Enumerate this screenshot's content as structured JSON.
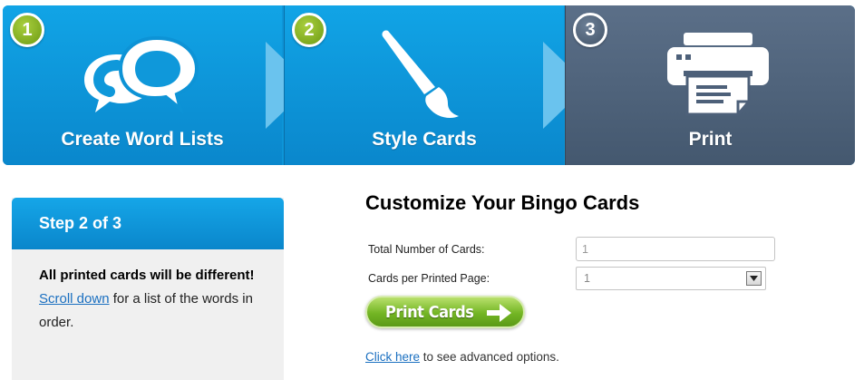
{
  "steps": [
    {
      "number": "1",
      "label": "Create Word Lists",
      "icon": "speech-bubbles-icon",
      "state": "complete"
    },
    {
      "number": "2",
      "label": "Style Cards",
      "icon": "paintbrush-icon",
      "state": "current"
    },
    {
      "number": "3",
      "label": "Print",
      "icon": "printer-icon",
      "state": "upcoming"
    }
  ],
  "sidebar": {
    "heading": "Step 2 of 3",
    "notice": "All printed cards will be different!",
    "scroll_link": "Scroll down",
    "scroll_text": " for a list of the words in order."
  },
  "form": {
    "title": "Customize Your Bingo Cards",
    "total_label": "Total Number of Cards:",
    "total_value": "1",
    "per_page_label": "Cards per Printed Page:",
    "per_page_value": "1",
    "print_button": "Print Cards",
    "advanced_link": "Click here",
    "advanced_text": " to see advanced options."
  },
  "colors": {
    "step_active": "#0a95db",
    "step_upcoming": "#4d6079",
    "step_number_complete": "#7aa51d",
    "button_green": "#6cae22",
    "link": "#1a6fc0"
  }
}
